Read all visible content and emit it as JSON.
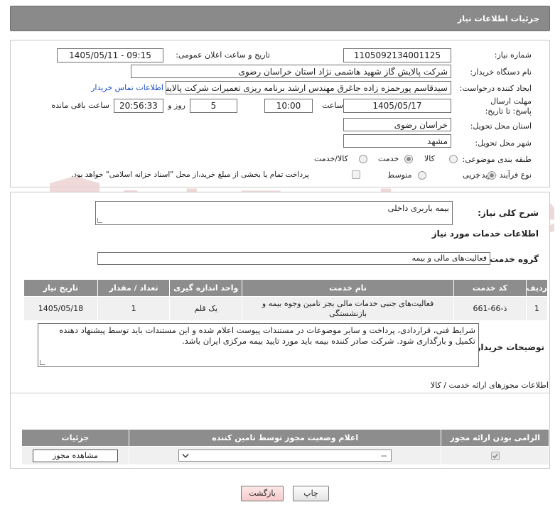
{
  "header": {
    "title": "جزئیات اطلاعات نیاز"
  },
  "form": {
    "need_number_label": "شماره نیاز:",
    "need_number": "1105092134001125",
    "announce_label": "تاریخ و ساعت اعلان عمومی:",
    "announce_value": "1405/05/11 - 09:15",
    "buyer_label": "نام دستگاه خریدار:",
    "buyer_value": "شرکت پالایش گاز شهید هاشمی نژاد   استان خراسان رضوی",
    "creator_label": "ایجاد کننده درخواست:",
    "creator_value": "سیدقاسم پورحمزه زاده جاغرق مهندس ارشد برنامه ریزی تعمیرات شرکت پالایش گاز شهید هاشمی نژاد",
    "contact_link": "اطلاعات تماس خریدار",
    "deadline_label": "مهلت ارسال پاسخ: تا تاریخ:",
    "deadline_date": "1405/05/17",
    "time_label": "ساعت",
    "deadline_time": "10:00",
    "days_value": "5",
    "days_label": "روز و",
    "remaining_time": "20:56:33",
    "remaining_label": "ساعت باقی مانده",
    "province_label": "استان محل تحویل:",
    "province_value": "خراسان رضوی",
    "city_label": "شهر محل تحویل:",
    "city_value": "مشهد",
    "category_label": "طبقه بندی موضوعی:",
    "category_options": [
      "کالا",
      "خدمت",
      "کالا/خدمت"
    ],
    "category_selected": "خدمت",
    "process_label": "نوع فرآیند خرید :",
    "process_options": [
      "جزیی",
      "متوسط"
    ],
    "process_selected": "جزیی",
    "payment_note": "پرداخت تمام یا بخشی از مبلغ خرید،از محل \"اسناد خزانه اسلامی\" خواهد بود."
  },
  "summary": {
    "label": "شرح کلی نیاز:",
    "value": "بیمه باربری داخلی"
  },
  "services": {
    "section_title": "اطلاعات خدمات مورد نیاز",
    "group_label": "گروه خدمت:",
    "group_value": "فعالیت‌های مالی و بیمه",
    "columns": [
      "ردیف",
      "کد خدمت",
      "نام خدمت",
      "واحد اندازه گیری",
      "تعداد / مقدار",
      "تاریخ نیاز"
    ],
    "rows": [
      {
        "index": "1",
        "code": "ذ-66-661",
        "name": "فعالیت‌های جنبی خدمات مالی بجز تامین وجوه بیمه و بازنشستگی",
        "unit": "یک قلم",
        "qty": "1",
        "date": "1405/05/18"
      }
    ]
  },
  "buyer_notes": {
    "label": "توضیحات خریدار:",
    "text": "شرایط فنی، قراردادی، پرداخت و سایر موضوعات در مستندات پیوست اعلام شده و این مستندات باید توسط پیشنهاد دهنده تکمیل و  بارگذاری شود. شرکت صادر کننده بیمه باید مورد تایید بیمه مرکزی ایران باشد."
  },
  "permits": {
    "section_title": "اطلاعات مجوزهای ارائه خدمت / کالا",
    "columns": [
      "الزامی بودن ارائه مجوز",
      "اعلام وضعیت مجوز توسط تامین کننده",
      "جزئیات"
    ],
    "select_value": "--",
    "view_button": "مشاهده مجوز"
  },
  "actions": {
    "print": "چاپ",
    "back": "بازگشت"
  },
  "watermark": {
    "text": "AriaTender.neT"
  },
  "colors": {
    "header_bg": "#8a8a8a",
    "link": "#1b4fc9",
    "table_header": "#8d8d8d",
    "watermark": "#e8c9c9"
  }
}
